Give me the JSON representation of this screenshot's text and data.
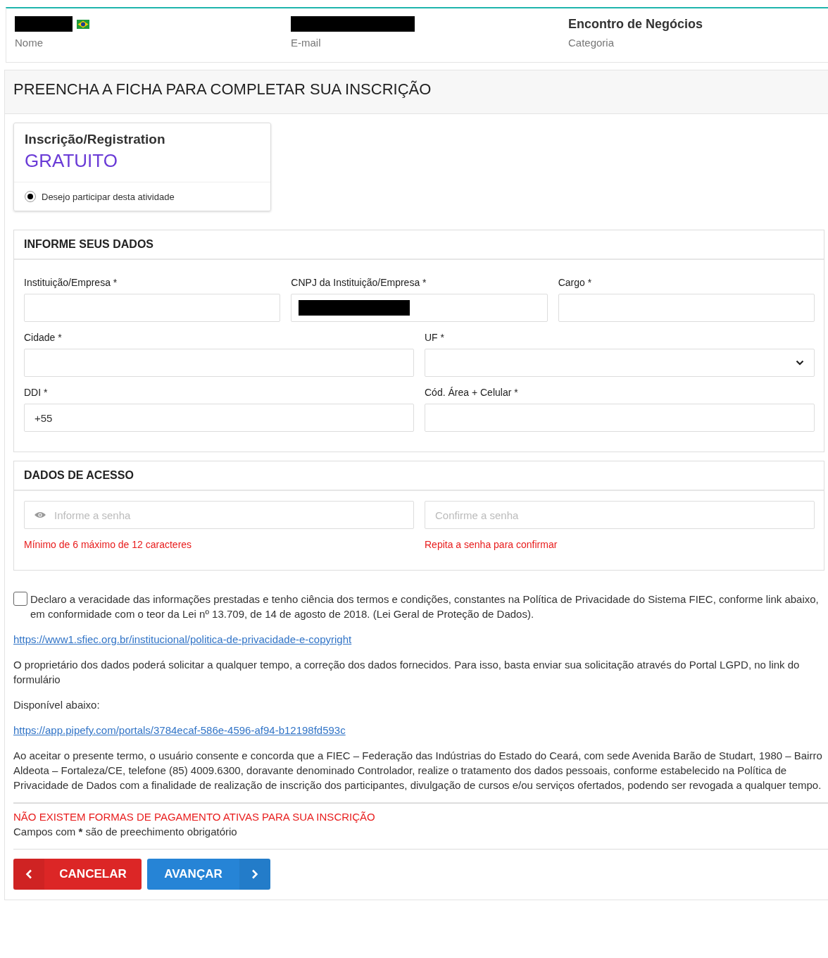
{
  "header": [
    {
      "label": "Nome",
      "redacted": true,
      "flag": true
    },
    {
      "label": "E-mail",
      "redacted": true
    },
    {
      "label": "Categoria",
      "value": "Encontro de Negócios"
    }
  ],
  "form_title": "PREENCHA A FICHA PARA COMPLETAR SUA INSCRIÇÃO",
  "ticket": {
    "title": "Inscrição/Registration",
    "price": "GRATUITO",
    "option": {
      "label": "Desejo participar desta atividade",
      "selected": true
    }
  },
  "sections": [
    {
      "title": "INFORME SEUS DADOS",
      "rows": [
        [
          {
            "label": "Instituição/Empresa *",
            "kind": "text"
          },
          {
            "label": "CNPJ da Instituição/Empresa *",
            "kind": "text",
            "redacted": true
          },
          {
            "label": "Cargo *",
            "kind": "text"
          }
        ],
        [
          {
            "label": "Cidade *",
            "kind": "text"
          },
          {
            "label": "UF *",
            "kind": "select"
          }
        ],
        [
          {
            "label": "DDI *",
            "kind": "text",
            "value": "+55"
          },
          {
            "label": "Cód. Área + Celular *",
            "kind": "text"
          }
        ]
      ]
    },
    {
      "title": "DADOS DE ACESSO",
      "rows": [
        [
          {
            "kind": "password",
            "placeholder": "Informe a senha",
            "hint": "Mínimo de 6 máximo de 12 caracteres"
          },
          {
            "kind": "text",
            "placeholder": "Confirme a senha",
            "hint": "Repita a senha para confirmar"
          }
        ]
      ]
    }
  ],
  "consent": {
    "checked": false,
    "text": "Declaro a veracidade das informações prestadas e tenho ciência dos termos e condições, constantes na Política de Privacidade do Sistema FIEC, conforme link abaixo, em conformidade com o teor da Lei nº 13.709, de 14 de agosto de 2018. (Lei Geral de Proteção de Dados)."
  },
  "paragraphs": [
    {
      "kind": "link",
      "text": "https://www1.sfiec.org.br/institucional/politica-de-privacidade-e-copyright"
    },
    {
      "kind": "text",
      "text": "O proprietário dos dados poderá solicitar a qualquer tempo, a correção dos dados fornecidos. Para isso, basta enviar sua solicitação através do Portal LGPD, no link do formulário"
    },
    {
      "kind": "text",
      "text": "Disponível abaixo:"
    },
    {
      "kind": "link",
      "text": "https://app.pipefy.com/portals/3784ecaf-586e-4596-af94-b12198fd593c"
    },
    {
      "kind": "text",
      "text": "Ao aceitar o presente termo, o usuário consente e concorda que a FIEC – Federação das Indústrias do Estado do Ceará, com sede Avenida Barão de Studart, 1980 – Bairro Aldeota – Fortaleza/CE, telefone (85) 4009.6300, doravante denominado Controlador, realize o tratamento dos dados pessoais, conforme estabelecido na Política de Privacidade de Dados com a finalidade de realização de inscrição dos participantes, divulgação de cursos e/ou serviços ofertados, podendo ser revogada a qualquer tempo."
    }
  ],
  "payment_notice": "NÃO EXISTEM FORMAS DE PAGAMENTO ATIVAS PARA SUA INSCRIÇÃO",
  "required_note": {
    "before": "Campos com",
    "mark": "*",
    "after": "são de preechimento obrigatório"
  },
  "buttons": [
    {
      "label": "CANCELAR",
      "kind": "back"
    },
    {
      "label": "AVANÇAR",
      "kind": "next"
    }
  ]
}
